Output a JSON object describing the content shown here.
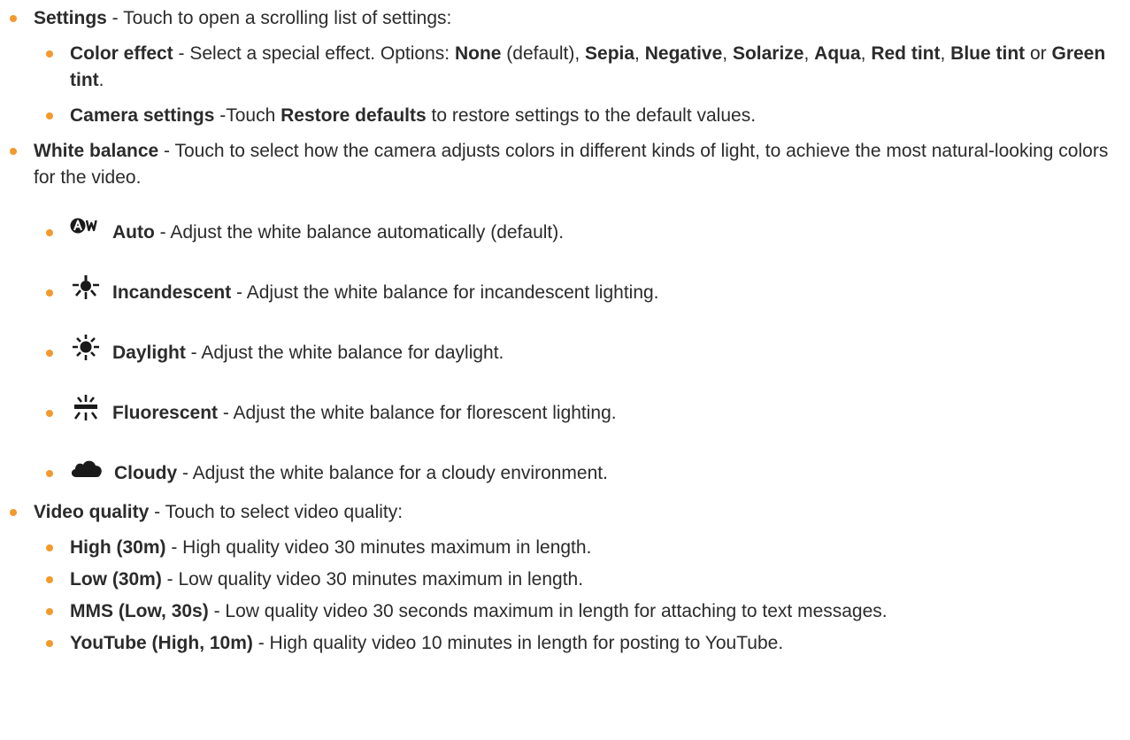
{
  "accent_color": "#f29a2e",
  "settings": {
    "title": "Settings",
    "text": " - Touch to open a scrolling list of settings:",
    "color_effect": {
      "title": "Color effect",
      "text1": " - Select a special effect. Options: ",
      "none": "None",
      "default_text": " (default), ",
      "sepia": "Sepia",
      "negative": "Negative",
      "solarize": "Solarize",
      "aqua": "Aqua",
      "red_tint": "Red tint",
      "blue_tint": "Blue tint",
      "or_text": " or ",
      "green_tint": "Green tint",
      "sep": ", ",
      "period": "."
    },
    "camera_settings": {
      "title": "Camera settings",
      "text1": " -Touch ",
      "restore": "Restore defaults",
      "text2": " to restore settings to the default values."
    }
  },
  "white_balance": {
    "title": "White balance",
    "text": " - Touch to select how the camera adjusts colors in different kinds of light, to achieve the most natural-looking colors for the video.",
    "options": [
      {
        "icon": "auto-wb-icon",
        "title": "Auto",
        "text": " - Adjust the white balance automatically (default)."
      },
      {
        "icon": "incandescent-icon",
        "title": "Incandescent",
        "text": " - Adjust the white balance for incandescent lighting."
      },
      {
        "icon": "daylight-icon",
        "title": "Daylight",
        "text": " - Adjust the white balance for daylight."
      },
      {
        "icon": "fluorescent-icon",
        "title": "Fluorescent",
        "text": " - Adjust the white balance for florescent lighting."
      },
      {
        "icon": "cloudy-icon",
        "title": "Cloudy",
        "text": " - Adjust the white balance for a cloudy environment."
      }
    ]
  },
  "video_quality": {
    "title": "Video quality",
    "text": " - Touch to select video quality:",
    "options": [
      {
        "title": "High (30m)",
        "text": " - High quality video 30 minutes maximum in length."
      },
      {
        "title": "Low (30m)",
        "text": " - Low quality video 30 minutes maximum in length."
      },
      {
        "title": "MMS (Low, 30s)",
        "text": " - Low quality video 30 seconds maximum in length for attaching to text messages."
      },
      {
        "title": "YouTube (High, 10m)",
        "text": " - High quality video 10 minutes in length for posting to YouTube."
      }
    ]
  }
}
